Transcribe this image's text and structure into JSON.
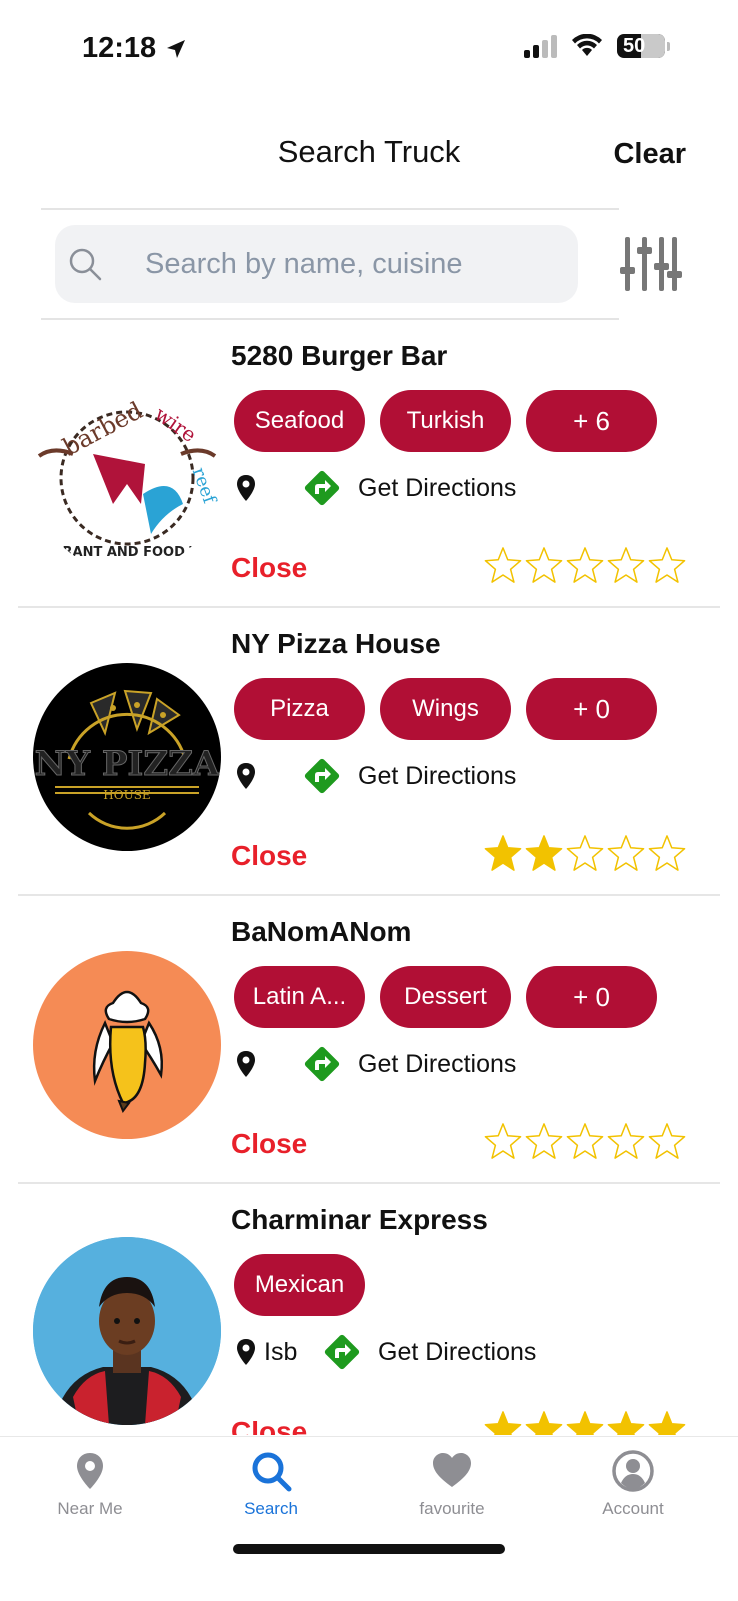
{
  "status_bar": {
    "time": "12:18",
    "battery": "50"
  },
  "header": {
    "title": "Search Truck",
    "clear_label": "Clear"
  },
  "search": {
    "placeholder": "Search by name, cuisine",
    "value": ""
  },
  "trucks": [
    {
      "name": "5280 Burger Bar",
      "tags": [
        "Seafood",
        "Turkish",
        "+ 6"
      ],
      "location": "",
      "directions_label": "Get Directions",
      "status": "Close",
      "rating": 0,
      "logo": "barbed wire reef restaurant and food trucks logo",
      "logo_text": "barbed wire reef RESTAURANT AND FOOD TRUCKS"
    },
    {
      "name": "NY Pizza House",
      "tags": [
        "Pizza",
        "Wings",
        "+ 0"
      ],
      "location": "",
      "directions_label": "Get Directions",
      "status": "Close",
      "rating": 2,
      "logo": "ny pizza house logo",
      "logo_text": "NY PIZZA HOUSE"
    },
    {
      "name": "BaNomANom",
      "tags": [
        "Latin A...",
        "Dessert",
        "+ 0"
      ],
      "location": "",
      "directions_label": "Get Directions",
      "status": "Close",
      "rating": 0,
      "logo": "banana ice cream logo"
    },
    {
      "name": "Charminar Express",
      "tags": [
        "Mexican"
      ],
      "location": "Isb",
      "directions_label": "Get Directions",
      "status": "Close",
      "rating": 5,
      "logo": "person avatar photo"
    }
  ],
  "tabs": [
    {
      "label": "Near Me",
      "icon": "map-pin-icon",
      "active": false
    },
    {
      "label": "Search",
      "icon": "search-icon",
      "active": true
    },
    {
      "label": "favourite",
      "icon": "heart-icon",
      "active": false
    },
    {
      "label": "Account",
      "icon": "account-icon",
      "active": false
    }
  ],
  "colors": {
    "tag": "#b10f35",
    "close": "#e8202a",
    "star": "#f2c200",
    "accent": "#1a73d9",
    "directions": "#1e9a1e"
  }
}
